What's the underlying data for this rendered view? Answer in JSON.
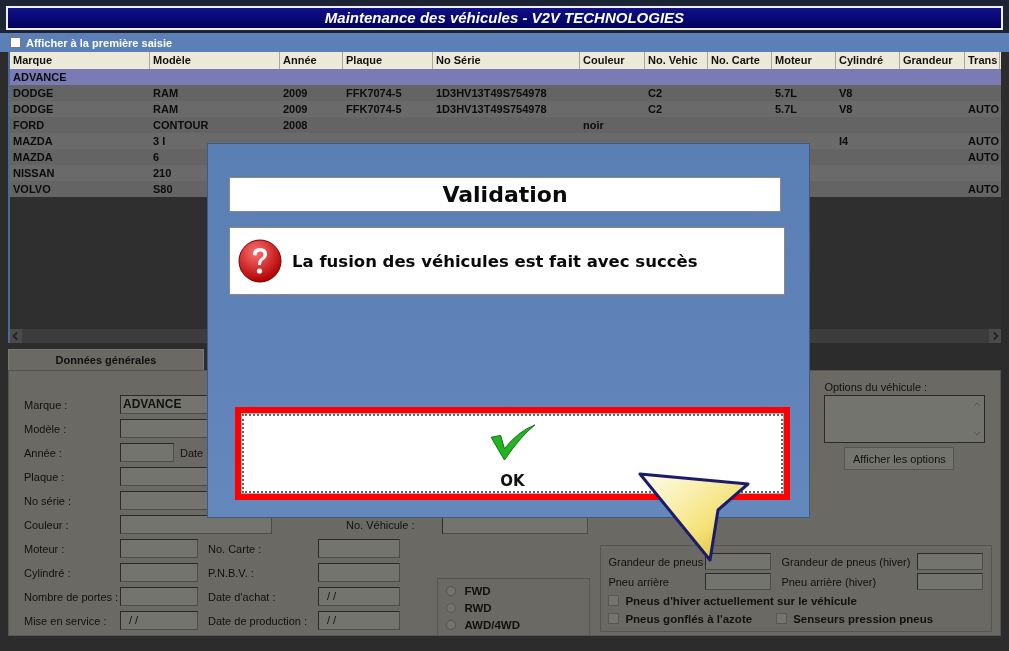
{
  "window": {
    "title": "Maintenance des véhicules - V2V TECHNOLOGIES"
  },
  "first_entry_option": {
    "label": "Afficher à la première saisie",
    "checked": false
  },
  "table": {
    "columns": [
      "Marque",
      "Modèle",
      "Année",
      "Plaque",
      "No Série",
      "Couleur",
      "No. Vehic",
      "No. Carte",
      "Moteur",
      "Cylindré",
      "Grandeur",
      "Trans"
    ],
    "rows": [
      {
        "selected": true,
        "marque": "ADVANCE"
      },
      {
        "selected": false,
        "marque": "DODGE",
        "modele": "RAM",
        "annee": "2009",
        "plaque": "FFK7074-5",
        "no_serie": "1D3HV13T49S754978",
        "no_vehicule": "C2",
        "moteur": "5.7L",
        "cylindre": "V8"
      },
      {
        "selected": false,
        "marque": "DODGE",
        "modele": "RAM",
        "annee": "2009",
        "plaque": "FFK7074-5",
        "no_serie": "1D3HV13T49S754978",
        "no_vehicule": "C2",
        "moteur": "5.7L",
        "cylindre": "V8",
        "transmission": "AUTO"
      },
      {
        "selected": false,
        "marque": "FORD",
        "modele": "CONTOUR",
        "annee": "2008",
        "couleur": "noir"
      },
      {
        "selected": false,
        "marque": "MAZDA",
        "modele": "3 I",
        "cylindre": "I4",
        "transmission": "AUTO"
      },
      {
        "selected": false,
        "marque": "MAZDA",
        "modele": "6",
        "transmission": "AUTO"
      },
      {
        "selected": false,
        "marque": "NISSAN",
        "modele": "210"
      },
      {
        "selected": false,
        "marque": "VOLVO",
        "modele": "S80",
        "transmission": "AUTO"
      }
    ]
  },
  "form": {
    "tabs": [
      {
        "label": "Données générales",
        "selected": true
      }
    ],
    "marque": {
      "label": "Marque :",
      "value": "ADVANCE"
    },
    "modele": {
      "label": "Modèle :"
    },
    "annee": {
      "label": "Année :"
    },
    "date_label": "Date",
    "plaque": {
      "label": "Plaque :"
    },
    "no_serie": {
      "label": "No série :"
    },
    "couleur": {
      "label": "Couleur :"
    },
    "no_vehicule": {
      "label": "No. Véhicule :"
    },
    "moteur": {
      "label": "Moteur :"
    },
    "no_carte": {
      "label": "No. Carte :"
    },
    "cylindre": {
      "label": "Cylindré :"
    },
    "pnbv": {
      "label": "P.N.B.V. :"
    },
    "nombre_portes": {
      "label": "Nombre de portes :"
    },
    "date_achat": {
      "label": "Date d'achat :",
      "value": "/ /"
    },
    "mise_en_service": {
      "label": "Mise en service :",
      "value": "/ /"
    },
    "date_production": {
      "label": "Date de production :",
      "value": "/ /"
    },
    "traction": [
      {
        "label": "FWD",
        "selected": false
      },
      {
        "label": "RWD",
        "selected": false
      },
      {
        "label": "AWD/4WD",
        "selected": false
      }
    ],
    "options_label": "Options du véhicule :",
    "options_button": "Afficher les options",
    "tire_fields": [
      "Grandeur de pneus",
      "Grandeur de pneus (hiver)",
      "Pneu arrière",
      "Pneu arrière (hiver)"
    ],
    "tire_checks": [
      {
        "label": "Pneus d'hiver actuellement sur le véhicule",
        "checked": false
      },
      {
        "label": "Pneus gonflés à l'azote",
        "checked": false
      },
      {
        "label": "Senseurs pression pneus",
        "checked": false
      }
    ]
  },
  "dialog": {
    "title": "Validation",
    "message": "La fusion des véhicules est fait avec succès",
    "button": "OK"
  }
}
